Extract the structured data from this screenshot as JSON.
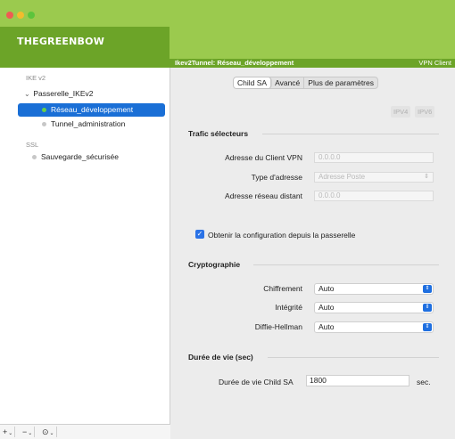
{
  "app": {
    "logo": "THEGREENBOW",
    "product": "VPN Client"
  },
  "header": {
    "tunnel_title": "Ikev2Tunnel: Réseau_développement"
  },
  "sidebar": {
    "sections": {
      "ikev2": "IKE v2",
      "ssl": "SSL"
    },
    "gateway": "Passerelle_IKEv2",
    "items": [
      {
        "label": "Réseau_développement",
        "selected": true
      },
      {
        "label": "Tunnel_administration",
        "selected": false
      },
      {
        "label": "Sauvegarde_sécurisée",
        "selected": false
      }
    ],
    "toolbar": {
      "add": "+",
      "remove": "−",
      "more": "⊙"
    }
  },
  "tabs": [
    "Child SA",
    "Avancé",
    "Plus de paramètres"
  ],
  "ip_version": {
    "ipv4": "IPV4",
    "ipv6": "IPV6"
  },
  "traffic_selectors": {
    "title": "Trafic sélecteurs",
    "client_address_label": "Adresse du Client VPN",
    "client_address_value": "0.0.0.0",
    "address_type_label": "Type d'adresse",
    "address_type_value": "Adresse Poste",
    "remote_network_label": "Adresse réseau distant",
    "remote_network_value": "0.0.0.0"
  },
  "gateway_config_checkbox": {
    "label": "Obtenir la configuration depuis la passerelle",
    "checked": true
  },
  "crypto": {
    "title": "Cryptographie",
    "encryption_label": "Chiffrement",
    "encryption_value": "Auto",
    "integrity_label": "Intégrité",
    "integrity_value": "Auto",
    "dh_label": "Diffie-Hellman",
    "dh_value": "Auto"
  },
  "lifetime": {
    "title": "Durée de vie (sec)",
    "child_sa_label": "Durée de vie Child SA",
    "child_sa_value": "1800",
    "unit": "sec."
  },
  "colors": {
    "green_dark": "#6ca428",
    "green_light": "#9bca4e",
    "selection": "#1a6fd6",
    "accent_blue": "#1f6fe0"
  }
}
